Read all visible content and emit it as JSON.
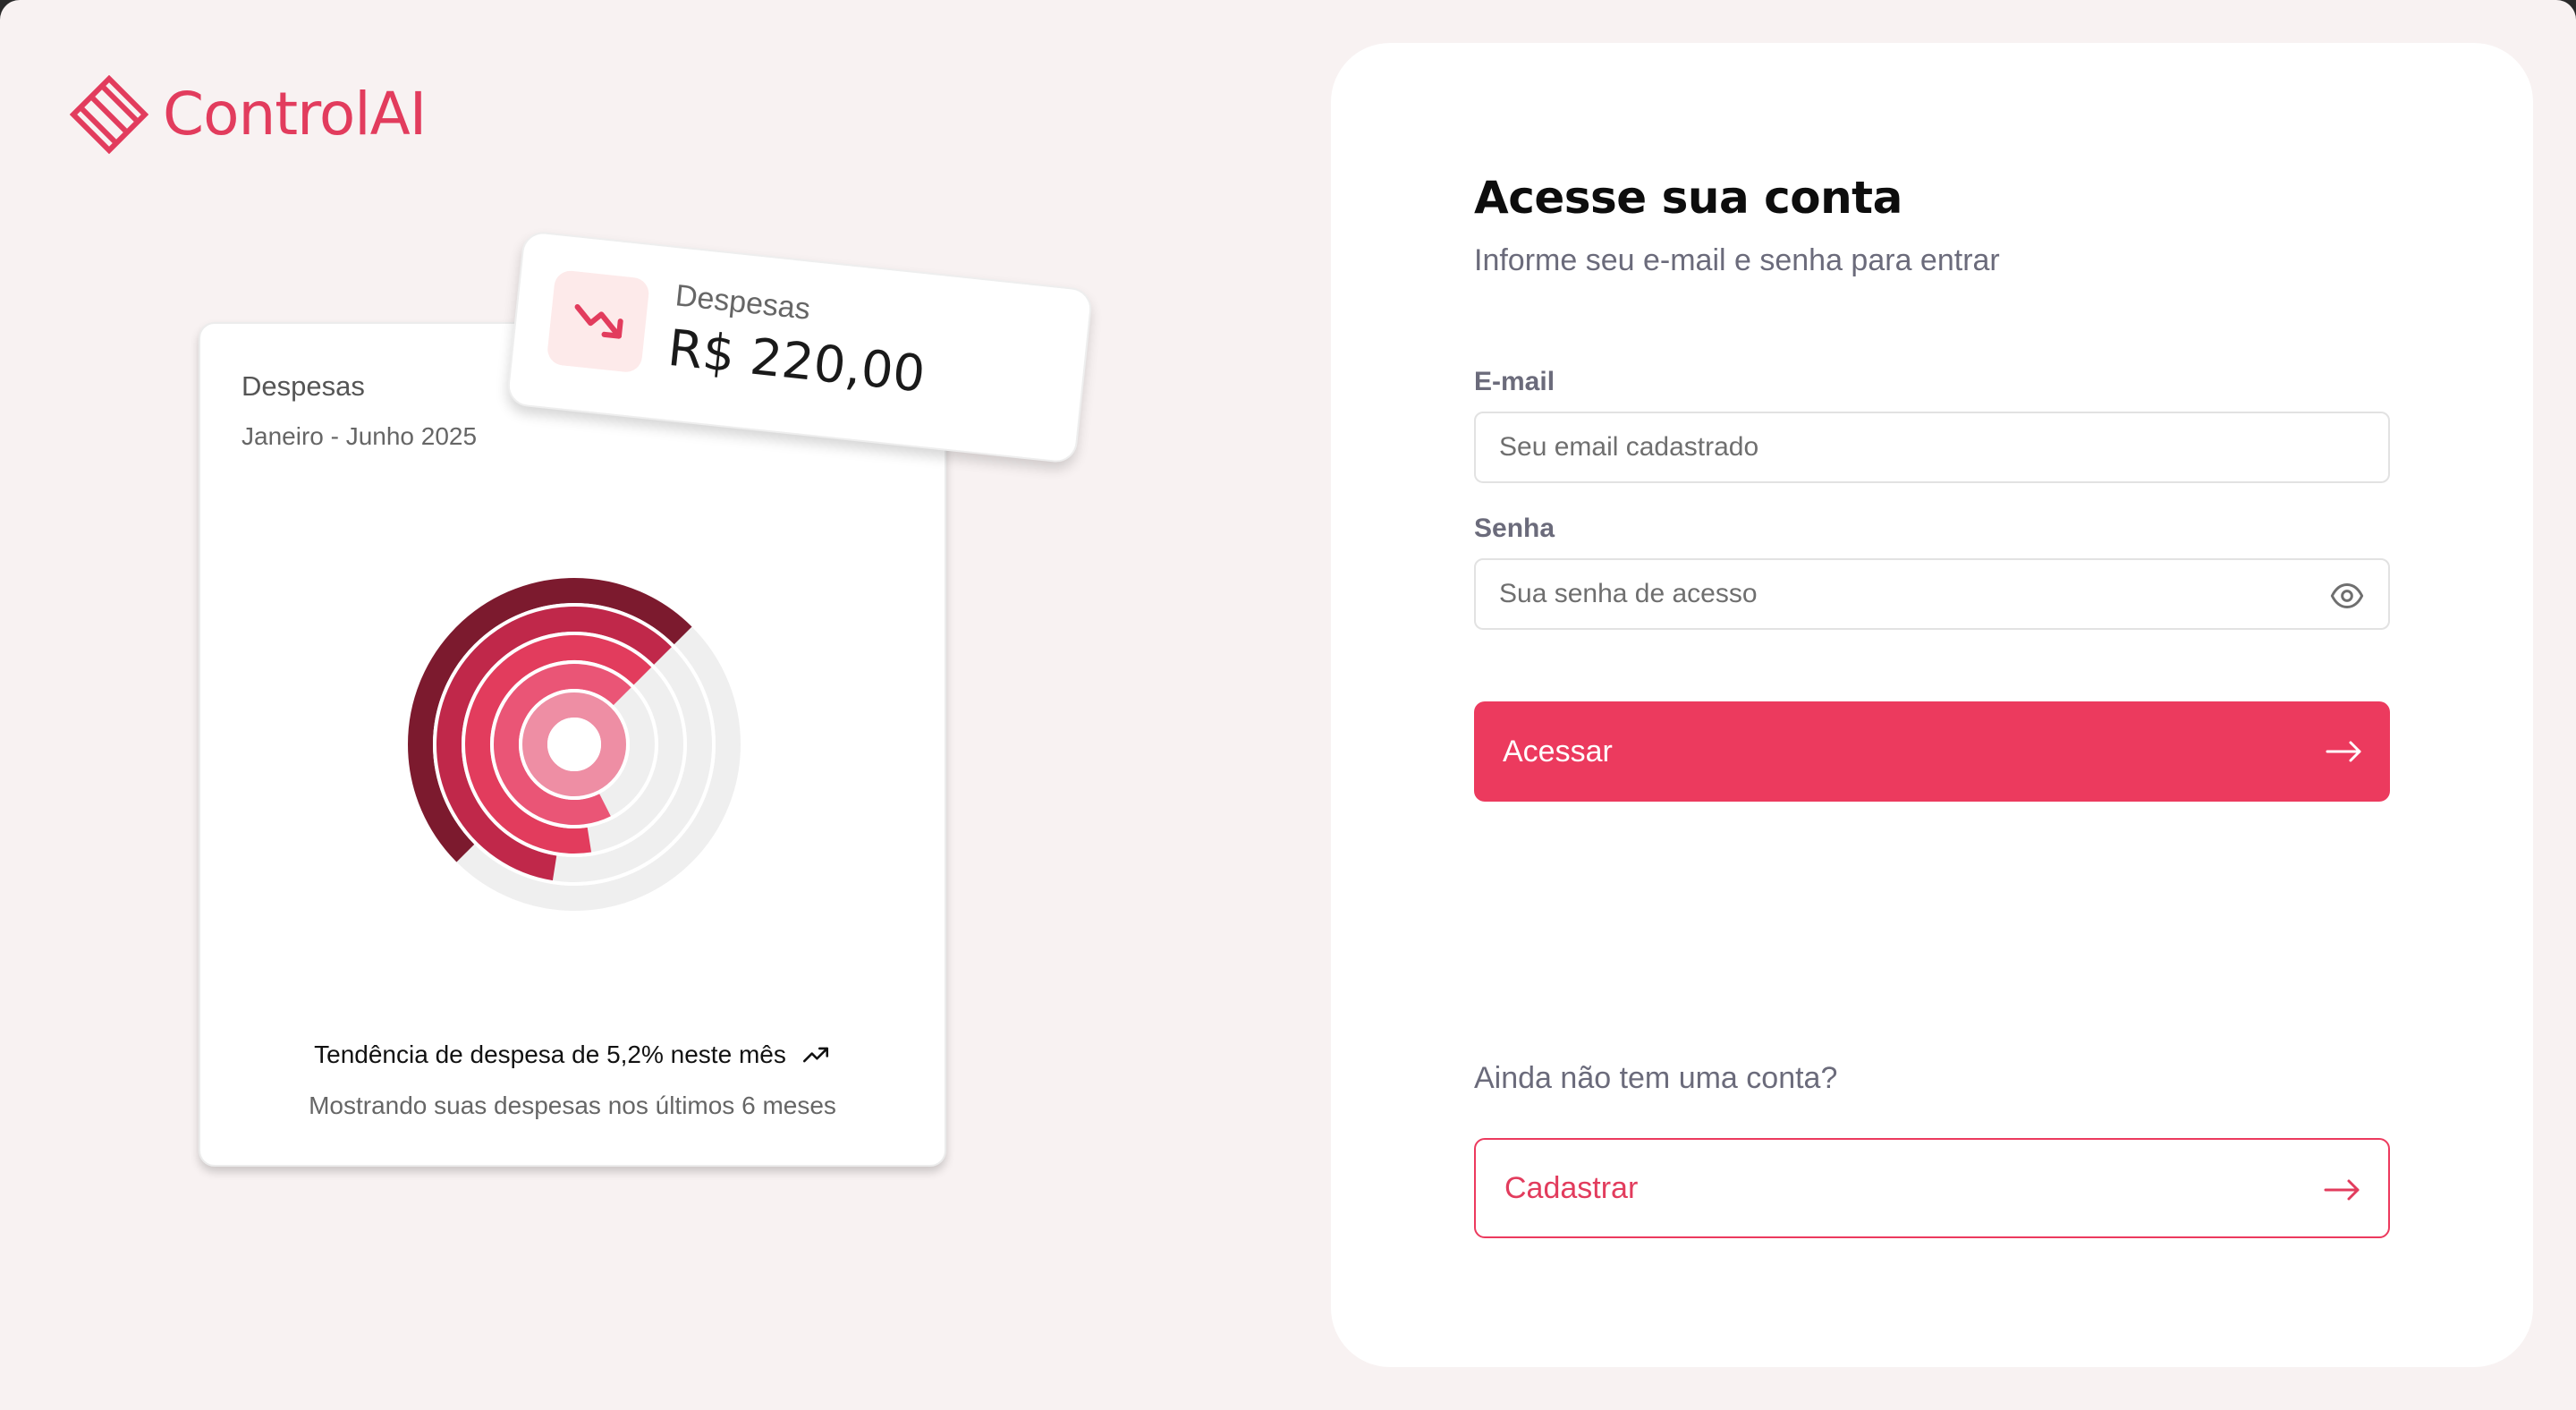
{
  "brand": {
    "name": "ControlAI",
    "color": "#e23c5d"
  },
  "expense_card": {
    "title": "Despesas",
    "period": "Janeiro - Junho 2025",
    "trend_text": "Tendência de despesa de 5,2% neste mês",
    "trend_icon": "trending-up-icon",
    "caption": "Mostrando suas despesas nos últimos 6 meses"
  },
  "floating_card": {
    "label": "Despesas",
    "value": "R$ 220,00",
    "icon": "trending-down-icon"
  },
  "chart_data": {
    "type": "radial-bar",
    "title": "Despesas",
    "subtitle": "Janeiro - Junho 2025",
    "series": [
      {
        "fraction": 0.5,
        "color": "#7c1a2e"
      },
      {
        "fraction": 0.6,
        "color": "#c0284a"
      },
      {
        "fraction": 0.65,
        "color": "#e23c5d"
      },
      {
        "fraction": 0.7,
        "color": "#ea5576"
      },
      {
        "fraction": 1.0,
        "color": "#ee8ea4"
      }
    ],
    "track_color": "#efefef"
  },
  "login": {
    "heading": "Acesse sua conta",
    "subheading": "Informe seu e-mail e senha para entrar",
    "email_label": "E-mail",
    "email_placeholder": "Seu email cadastrado",
    "password_label": "Senha",
    "password_placeholder": "Sua senha de acesso",
    "password_toggle_icon": "eye-icon",
    "submit_label": "Acessar",
    "submit_icon": "arrow-right-icon",
    "signup_question": "Ainda não tem uma conta?",
    "signup_label": "Cadastrar",
    "signup_icon": "arrow-right-icon"
  },
  "colors": {
    "accent": "#ec3a5e",
    "page_bg": "#f8f2f2",
    "panel_bg": "#ffffff"
  }
}
